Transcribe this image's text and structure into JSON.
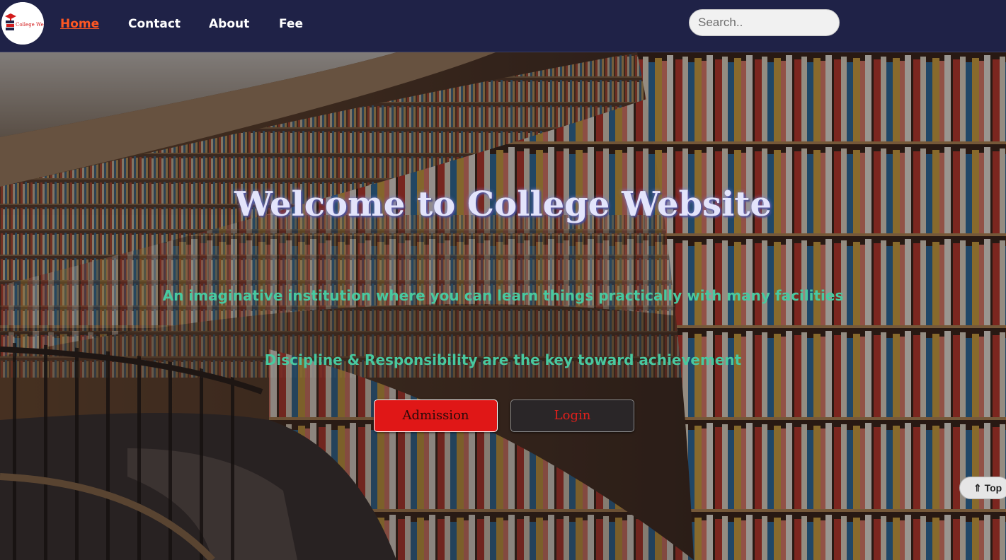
{
  "navbar": {
    "logo_text": "College Website",
    "links": [
      {
        "label": "Home",
        "active": true
      },
      {
        "label": "Contact",
        "active": false
      },
      {
        "label": "About",
        "active": false
      },
      {
        "label": "Fee",
        "active": false
      }
    ],
    "search": {
      "placeholder": "Search.."
    }
  },
  "hero": {
    "title": "Welcome to College Website",
    "subtitle_1": "An imaginative institution where you can learn things practically with many facilities",
    "subtitle_2": "Discipline & Responsibility are the key toward achievement",
    "admission_button": "Admission",
    "login_button": "Login",
    "background": "library-bookshelves-photo"
  },
  "scroll_top_button": "⇑ Top",
  "colors": {
    "nav_bg": "#1f2247",
    "active_link": "#ff5722",
    "title": "#e3e4fb",
    "subtitle": "#48c9a0",
    "admission_bg": "#e01717",
    "login_text": "#e0201c"
  }
}
